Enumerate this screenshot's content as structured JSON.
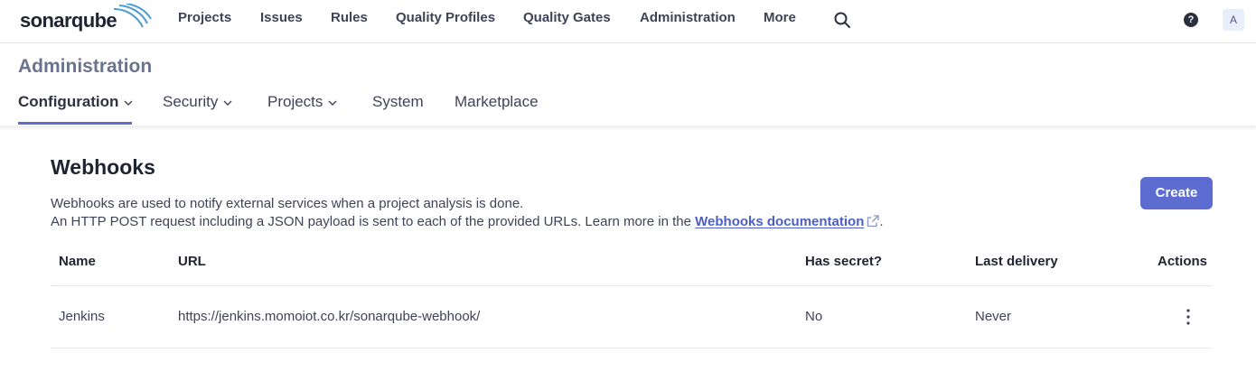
{
  "brand": {
    "logo_text": "sonarqube"
  },
  "nav": {
    "items": [
      {
        "label": "Projects"
      },
      {
        "label": "Issues"
      },
      {
        "label": "Rules"
      },
      {
        "label": "Quality Profiles"
      },
      {
        "label": "Quality Gates"
      },
      {
        "label": "Administration"
      },
      {
        "label": "More"
      }
    ],
    "search_icon": "search-icon",
    "help_label": "?",
    "avatar_initial": "A"
  },
  "admin": {
    "title": "Administration",
    "tabs": [
      {
        "label": "Configuration",
        "dropdown": true,
        "active": true
      },
      {
        "label": "Security",
        "dropdown": true
      },
      {
        "label": "Projects",
        "dropdown": true
      },
      {
        "label": "System",
        "dropdown": false
      },
      {
        "label": "Marketplace",
        "dropdown": false
      }
    ]
  },
  "webhooks": {
    "title": "Webhooks",
    "description_line1": "Webhooks are used to notify external services when a project analysis is done.",
    "description_line2_prefix": "An HTTP POST request including a JSON payload is sent to each of the provided URLs. Learn more in the ",
    "doc_link_label": "Webhooks documentation",
    "description_line2_suffix": ".",
    "create_label": "Create",
    "columns": {
      "name": "Name",
      "url": "URL",
      "has_secret": "Has secret?",
      "last_delivery": "Last delivery",
      "actions": "Actions"
    },
    "rows": [
      {
        "name": "Jenkins",
        "url": "https://jenkins.momoiot.co.kr/sonarqube-webhook/",
        "has_secret": "No",
        "last_delivery": "Never"
      }
    ]
  },
  "colors": {
    "accent": "#5d6cd0",
    "link": "#4b5fc7",
    "admin_title": "#6a7390"
  }
}
